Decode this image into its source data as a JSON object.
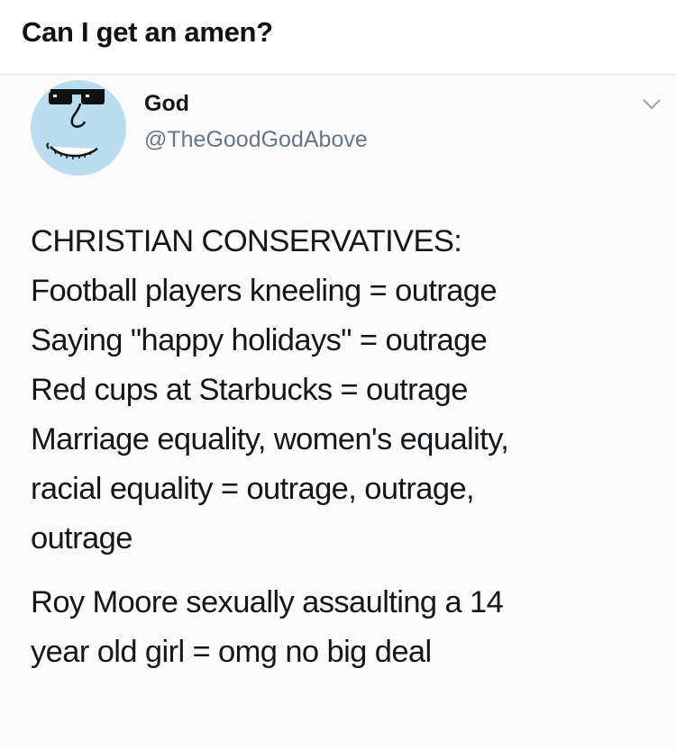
{
  "post": {
    "title": "Can I get an amen?"
  },
  "tweet": {
    "author_name": "God",
    "author_handle": "@TheGoodGodAbove",
    "avatar_icon": "sunglasses-face-avatar",
    "menu_icon": "chevron-down-icon",
    "body_paragraphs": [
      {
        "lines": [
          "CHRISTIAN CONSERVATIVES:",
          "Football players kneeling = outrage",
          "Saying \"happy holidays\" = outrage",
          "Red cups at Starbucks = outrage",
          "Marriage equality, women's equality,",
          "racial equality = outrage, outrage,",
          "outrage"
        ]
      },
      {
        "lines": [
          "Roy Moore sexually assaulting a 14",
          "year old girl = omg no big deal"
        ]
      }
    ]
  },
  "colors": {
    "avatar_bg": "#b9dcef",
    "handle": "#657786",
    "text": "#14171a"
  }
}
